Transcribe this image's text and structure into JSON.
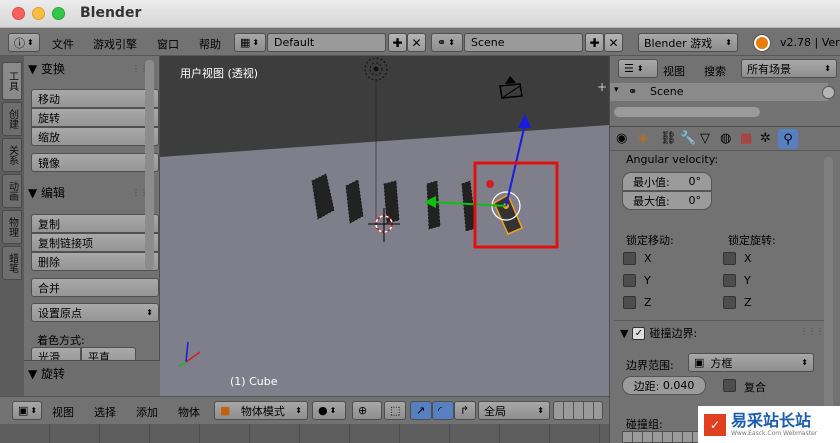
{
  "titlebar": {
    "app_title": "Blender"
  },
  "info_header": {
    "menus": [
      "文件",
      "游戏引擎",
      "窗口",
      "帮助"
    ],
    "screen_layout": "Default",
    "scene": "Scene",
    "render_engine": "Blender 游戏",
    "version": "v2.78 | Ver"
  },
  "left_tabs": [
    "工具",
    "创建",
    "关系",
    "动画",
    "物理",
    "蜡笔"
  ],
  "tool_shelf": {
    "transform_header": "▼ 变换",
    "transform_buttons": [
      "移动",
      "旋转",
      "缩放"
    ],
    "mirror_button": "镜像",
    "edit_header": "▼ 编辑",
    "edit_buttons": [
      "复制",
      "复制链接项",
      "删除"
    ],
    "join_button": "合并",
    "set_origin": "设置原点",
    "shading_label": "着色方式:",
    "shading_options": [
      "光滑",
      "平直"
    ],
    "rotate_header": "▼ 旋转"
  },
  "viewport": {
    "view_label": "用户视图 (透视)",
    "object_label": "(1) Cube"
  },
  "bottom_bar": {
    "menus": [
      "视图",
      "选择",
      "添加",
      "物体"
    ],
    "mode": "物体模式",
    "pivot": "全局"
  },
  "outliner": {
    "menus": [
      "视图",
      "搜索"
    ],
    "filter": "所有场景",
    "tree_item": "Scene"
  },
  "properties": {
    "angular_velocity_label": "Angular velocity:",
    "min_label": "最小值:",
    "min_value": "0°",
    "max_label": "最大值:",
    "max_value": "0°",
    "lock_move_label": "锁定移动:",
    "lock_rotate_label": "锁定旋转:",
    "axes": [
      "X",
      "Y",
      "Z"
    ],
    "collision_header": "碰撞边界:",
    "bounds_label": "边界范围:",
    "bounds_value": "方框",
    "margin_label": "边距:",
    "margin_value": "0.040",
    "compound_label": "复合",
    "collision_group_label": "碰撞组:"
  },
  "watermark": {
    "text": "易采站长站",
    "sub": "Www.Easck.Com Webmaster"
  },
  "colors": {
    "selection_box": "#e01010",
    "active_object": "#f0a020",
    "manipulator_z": "#1a1ae0",
    "manipulator_y": "#10c010"
  }
}
